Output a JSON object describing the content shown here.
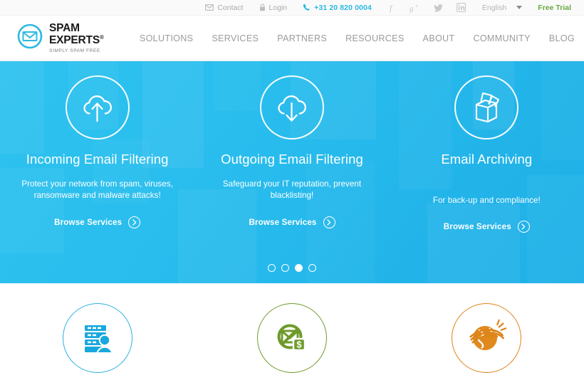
{
  "topbar": {
    "contact": "Contact",
    "login": "Login",
    "phone": "+31 20 820 0004",
    "social": [
      {
        "name": "facebook-icon",
        "glyph": "f"
      },
      {
        "name": "googleplus-icon",
        "glyph": "g+"
      },
      {
        "name": "twitter-icon",
        "glyph": "t"
      },
      {
        "name": "linkedin-icon",
        "glyph": "in"
      }
    ],
    "language": "English",
    "free_trial": "Free Trial",
    "phone_color": "#2bb9e4",
    "trial_color": "#69a844"
  },
  "header": {
    "logo_main": "SPAM EXPERTS",
    "logo_registered": "®",
    "logo_tagline": "SIMPLY SPAM FREE",
    "logo_color": "#2bb9e4",
    "nav": [
      {
        "label": "SOLUTIONS"
      },
      {
        "label": "SERVICES"
      },
      {
        "label": "PARTNERS"
      },
      {
        "label": "RESOURCES"
      },
      {
        "label": "ABOUT"
      },
      {
        "label": "COMMUNITY"
      },
      {
        "label": "BLOG"
      }
    ]
  },
  "hero": {
    "background_color": "#29bdee",
    "cards": [
      {
        "icon": "cloud-upload-icon",
        "title": "Incoming Email Filtering",
        "description": "Protect your network from spam, viruses, ransomware and malware attacks!",
        "cta": "Browse Services"
      },
      {
        "icon": "cloud-download-icon",
        "title": "Outgoing Email Filtering",
        "description": "Safeguard your IT reputation, prevent blacklisting!",
        "cta": "Browse Services"
      },
      {
        "icon": "archive-box-icon",
        "title": "Email Archiving",
        "description": "For back-up and compliance!",
        "cta": "Browse Services"
      }
    ],
    "carousel": {
      "count": 4,
      "active_index": 2
    }
  },
  "features": [
    {
      "icon": "server-user-icon",
      "color": "#2bb0dd",
      "label": ""
    },
    {
      "icon": "no-spam-dollar-icon",
      "color": "#6f9a2b",
      "label": ""
    },
    {
      "icon": "globe-swoosh-icon",
      "color": "#dd8418",
      "label": ""
    }
  ]
}
